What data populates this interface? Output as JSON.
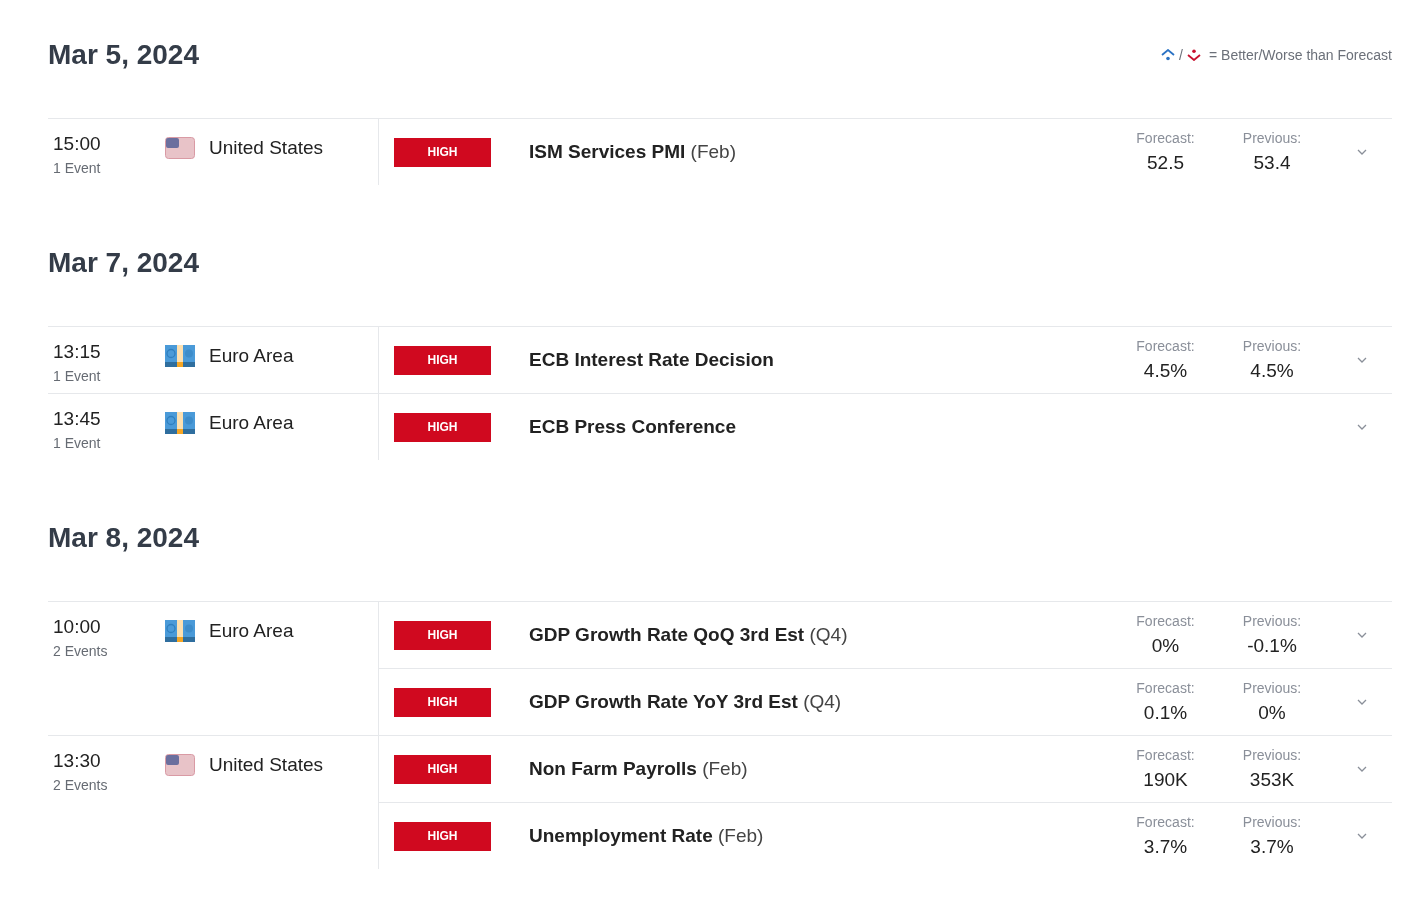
{
  "legend": {
    "separator": "/",
    "text": "= Better/Worse than Forecast"
  },
  "days": [
    {
      "date": "Mar 5, 2024",
      "groups": [
        {
          "time": "15:00",
          "count": "1 Event",
          "country": "United States",
          "kind": "us",
          "events": [
            {
              "impact": "HIGH",
              "title": "ISM Services PMI",
              "period": "(Feb)",
              "forecast_label": "Forecast:",
              "forecast": "52.5",
              "previous_label": "Previous:",
              "previous": "53.4"
            }
          ]
        }
      ]
    },
    {
      "date": "Mar 7, 2024",
      "groups": [
        {
          "time": "13:15",
          "count": "1 Event",
          "country": "Euro Area",
          "kind": "eu",
          "events": [
            {
              "impact": "HIGH",
              "title": "ECB Interest Rate Decision",
              "forecast_label": "Forecast:",
              "forecast": "4.5%",
              "previous_label": "Previous:",
              "previous": "4.5%"
            }
          ]
        },
        {
          "time": "13:45",
          "count": "1 Event",
          "country": "Euro Area",
          "kind": "eu",
          "events": [
            {
              "impact": "HIGH",
              "title": "ECB Press Conference"
            }
          ]
        }
      ]
    },
    {
      "date": "Mar 8, 2024",
      "groups": [
        {
          "time": "10:00",
          "count": "2 Events",
          "country": "Euro Area",
          "kind": "eu",
          "events": [
            {
              "impact": "HIGH",
              "title": "GDP Growth Rate QoQ 3rd Est",
              "period": "(Q4)",
              "forecast_label": "Forecast:",
              "forecast": "0%",
              "previous_label": "Previous:",
              "previous": "-0.1%"
            },
            {
              "impact": "HIGH",
              "title": "GDP Growth Rate YoY 3rd Est",
              "period": "(Q4)",
              "forecast_label": "Forecast:",
              "forecast": "0.1%",
              "previous_label": "Previous:",
              "previous": "0%"
            }
          ]
        },
        {
          "time": "13:30",
          "count": "2 Events",
          "country": "United States",
          "kind": "us",
          "events": [
            {
              "impact": "HIGH",
              "title": "Non Farm Payrolls",
              "period": "(Feb)",
              "forecast_label": "Forecast:",
              "forecast": "190K",
              "previous_label": "Previous:",
              "previous": "353K"
            },
            {
              "impact": "HIGH",
              "title": "Unemployment Rate",
              "period": "(Feb)",
              "forecast_label": "Forecast:",
              "forecast": "3.7%",
              "previous_label": "Previous:",
              "previous": "3.7%"
            }
          ]
        }
      ]
    }
  ]
}
